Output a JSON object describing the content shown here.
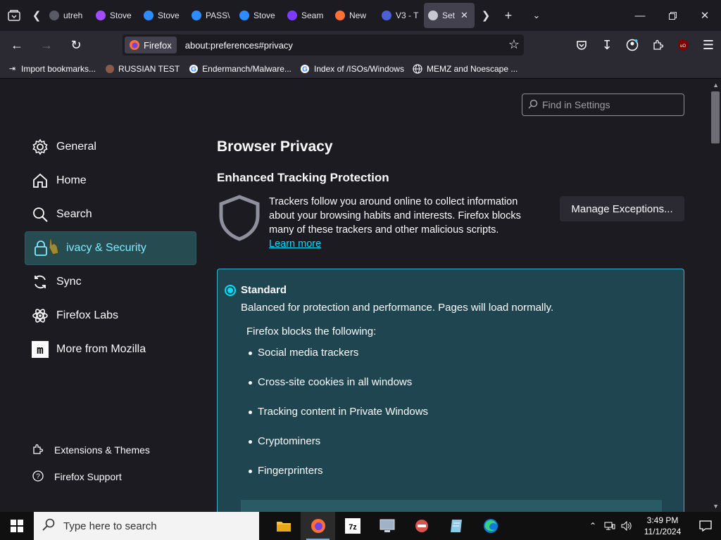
{
  "tabs": [
    {
      "title": "utreh",
      "favicon_color": "#5a5a66"
    },
    {
      "title": "Stove",
      "favicon_color": "#a14cff"
    },
    {
      "title": "Stove",
      "favicon_color": "#2d8cff"
    },
    {
      "title": "PASS\\",
      "favicon_color": "#2d8cff"
    },
    {
      "title": "Stove",
      "favicon_color": "#2d8cff"
    },
    {
      "title": "Seam",
      "favicon_color": "#7b3cff"
    },
    {
      "title": "New",
      "favicon_color": "#ff7139"
    },
    {
      "title": "V3 - T",
      "favicon_color": "#4b5fd6"
    },
    {
      "title": "Set",
      "favicon_color": "#c8c8d0",
      "active": true
    }
  ],
  "navbar": {
    "identity_label": "Firefox",
    "url": "about:preferences#privacy"
  },
  "bookmarks": [
    {
      "label": "Import bookmarks...",
      "icon": "import-icon"
    },
    {
      "label": "RUSSIAN TEST",
      "icon": "site-icon"
    },
    {
      "label": "Endermanch/Malware...",
      "icon": "google-icon"
    },
    {
      "label": "Index of /ISOs/Windows",
      "icon": "google-icon"
    },
    {
      "label": "MEMZ and Noescape ...",
      "icon": "globe-icon"
    }
  ],
  "search": {
    "placeholder": "Find in Settings"
  },
  "categories": [
    {
      "label": "General",
      "icon": "gear-icon"
    },
    {
      "label": "Home",
      "icon": "home-icon"
    },
    {
      "label": "Search",
      "icon": "search-icon"
    },
    {
      "label": "ivacy & Security",
      "icon": "lock-icon",
      "selected": true
    },
    {
      "label": "Sync",
      "icon": "sync-icon"
    },
    {
      "label": "Firefox Labs",
      "icon": "labs-icon"
    },
    {
      "label": "More from Mozilla",
      "icon": "mozilla-icon"
    }
  ],
  "footer_links": [
    {
      "label": "Extensions & Themes",
      "icon": "puzzle-icon"
    },
    {
      "label": "Firefox Support",
      "icon": "help-icon"
    }
  ],
  "main": {
    "page_title": "Browser Privacy",
    "section_title": "Enhanced Tracking Protection",
    "description": "Trackers follow you around online to collect information about your browsing habits and interests. Firefox blocks many of these trackers and other malicious scripts.",
    "learn_more": "Learn more",
    "manage_exceptions": "Manage Exceptions..."
  },
  "standard": {
    "label": "Standard",
    "description": "Balanced for protection and performance. Pages will load normally.",
    "blocks_title": "Firefox blocks the following:",
    "items": [
      "Social media trackers",
      "Cross-site cookies in all windows",
      "Tracking content in Private Windows",
      "Cryptominers",
      "Fingerprinters"
    ]
  },
  "taskbar": {
    "search_placeholder": "Type here to search",
    "time": "3:49 PM",
    "date": "11/1/2024"
  },
  "colors": {
    "accent": "#00ddff",
    "selected_bg": "#264b51",
    "card_bg": "#1f4650"
  }
}
